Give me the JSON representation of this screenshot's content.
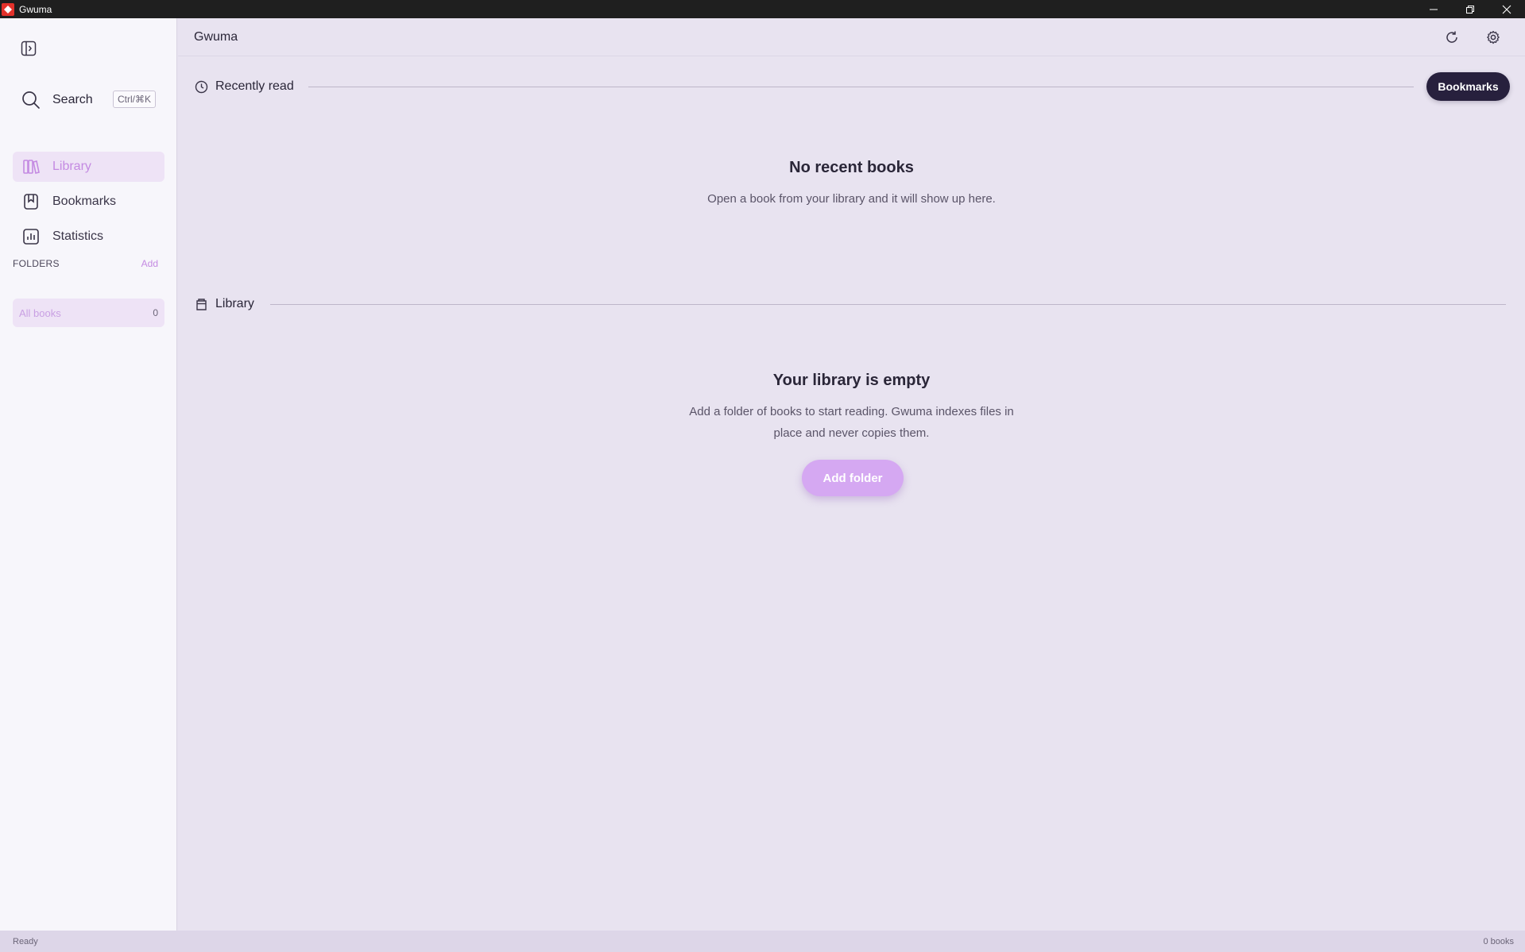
{
  "window": {
    "title": "Gwuma"
  },
  "sidebar": {
    "search": {
      "label": "Search",
      "shortcut": "Ctrl/⌘K"
    },
    "nav": [
      {
        "label": "Library",
        "icon": "library-icon",
        "active": true
      },
      {
        "label": "Bookmarks",
        "icon": "bookmark-icon",
        "active": false
      },
      {
        "label": "Statistics",
        "icon": "statistics-icon",
        "active": false
      }
    ],
    "folders": {
      "title": "FOLDERS",
      "add_label": "Add",
      "items": [
        {
          "label": "All books",
          "count": "0"
        }
      ]
    }
  },
  "header": {
    "title": "Gwuma"
  },
  "recent": {
    "title": "Recently read",
    "bookmarks_button": "Bookmarks",
    "empty_title": "No recent books",
    "empty_text": "Open a book from your library and it will show up here."
  },
  "library": {
    "title": "Library",
    "empty_title": "Your library is empty",
    "empty_text_line1": "Add a folder of books to start reading. Gwuma indexes files in",
    "empty_text_line2": "place and never copies them.",
    "add_folder_button": "Add folder"
  },
  "status": {
    "left": "Ready",
    "right": "0 books"
  },
  "colors": {
    "accent": "#c48ae2",
    "accent_button": "#d5a8f2",
    "dark_pill": "#27203d",
    "background": "#e8e3f0",
    "sidebar_background": "#f7f6fb"
  }
}
